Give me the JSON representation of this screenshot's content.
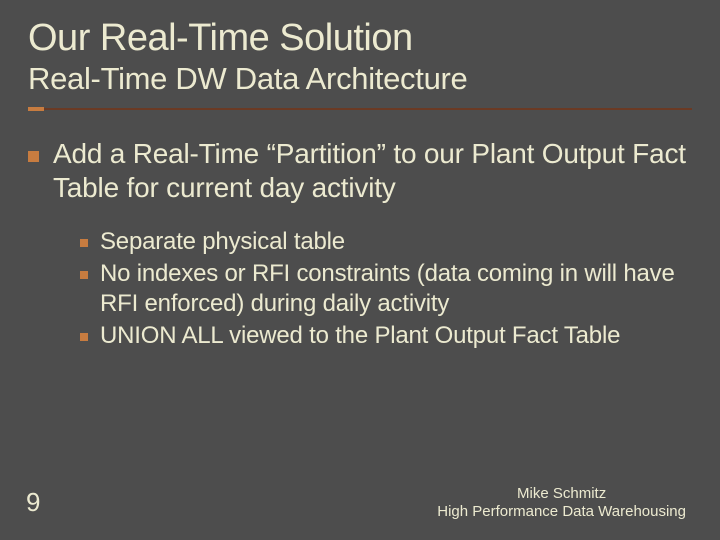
{
  "title": "Our Real-Time Solution",
  "subtitle": "Real-Time DW Data Architecture",
  "bullet_main": "Add a Real-Time “Partition” to our Plant Output Fact Table for current day activity",
  "sub_bullets": [
    "Separate physical table",
    "No indexes or RFI constraints (data coming in will have RFI enforced) during daily activity",
    "UNION ALL viewed to the Plant Output Fact Table"
  ],
  "page_number": "9",
  "footer_name": "Mike Schmitz",
  "footer_line2": "High Performance Data Warehousing"
}
